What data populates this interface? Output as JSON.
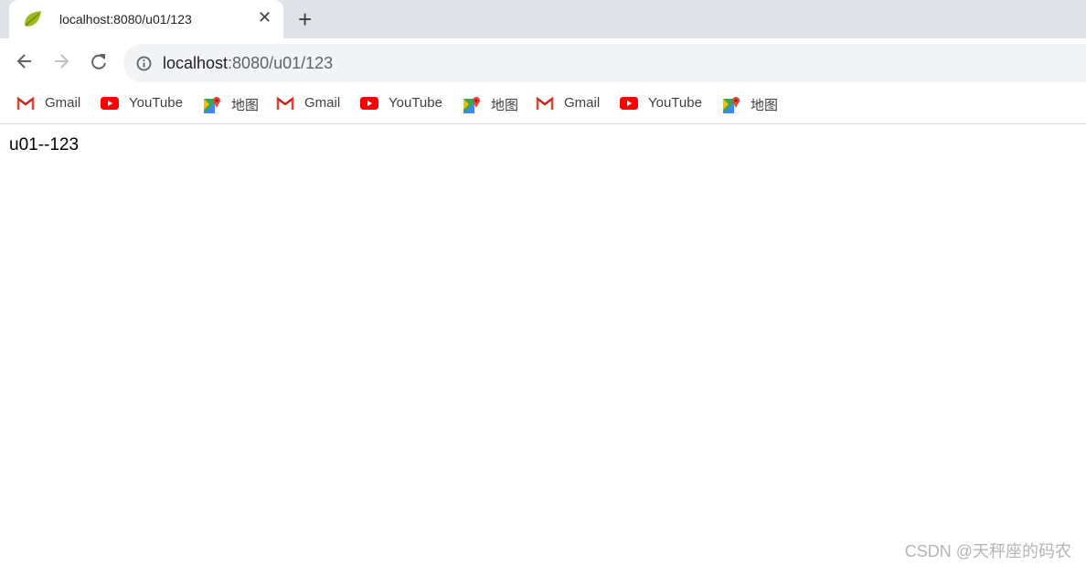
{
  "tab": {
    "title": "localhost:8080/u01/123",
    "favicon": "spring-leaf-icon",
    "close": "✕",
    "new_tab": "+"
  },
  "toolbar": {
    "back": "arrow-left-icon",
    "forward": "arrow-right-icon",
    "reload": "reload-icon"
  },
  "omnibox": {
    "host": "localhost",
    "rest": ":8080/u01/123",
    "icon": "info-icon"
  },
  "bookmarks": [
    {
      "label": "Gmail",
      "icon": "gmail-icon"
    },
    {
      "label": "YouTube",
      "icon": "youtube-icon"
    },
    {
      "label": "地图",
      "icon": "maps-icon"
    },
    {
      "label": "Gmail",
      "icon": "gmail-icon"
    },
    {
      "label": "YouTube",
      "icon": "youtube-icon"
    },
    {
      "label": "地图",
      "icon": "maps-icon"
    },
    {
      "label": "Gmail",
      "icon": "gmail-icon"
    },
    {
      "label": "YouTube",
      "icon": "youtube-icon"
    },
    {
      "label": "地图",
      "icon": "maps-icon"
    }
  ],
  "page": {
    "text": "u01--123"
  },
  "watermark": "CSDN @天秤座的码农"
}
